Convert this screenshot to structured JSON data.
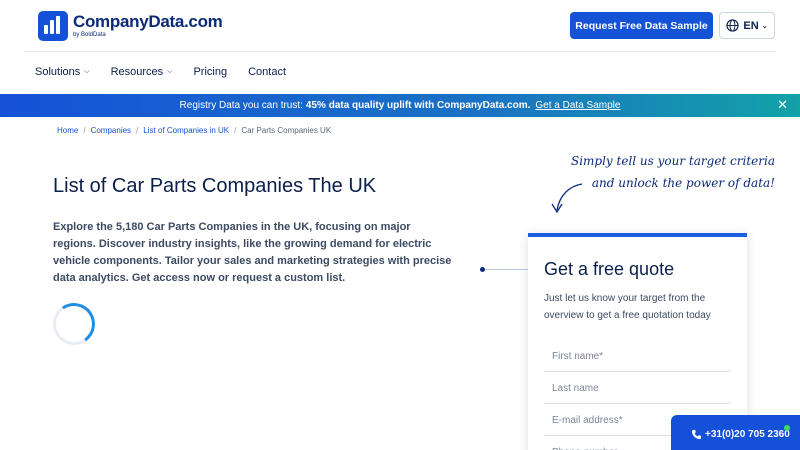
{
  "header": {
    "logo_name": "CompanyData.com",
    "logo_sub": "by BoldData",
    "cta_label": "Request Free Data Sample",
    "language": "EN"
  },
  "nav": {
    "items": [
      {
        "label": "Solutions",
        "has_dropdown": true
      },
      {
        "label": "Resources",
        "has_dropdown": true
      },
      {
        "label": "Pricing",
        "has_dropdown": false
      },
      {
        "label": "Contact",
        "has_dropdown": false
      }
    ]
  },
  "banner": {
    "text": "Registry Data you can trust:",
    "highlight": "45% data quality uplift with CompanyData.com.",
    "link": "Get a Data Sample",
    "close_icon": "close-icon"
  },
  "breadcrumb": [
    "Home",
    "Companies",
    "List of Companies in UK",
    "Car Parts Companies UK"
  ],
  "main": {
    "title": "List of Car Parts Companies The UK",
    "description": "Explore the 5,180 Car Parts Companies in the UK, focusing on major regions. Discover industry insights, like the growing demand for electric vehicle components. Tailor your sales and marketing strategies with precise data analytics. Get access now or request a custom list."
  },
  "callout": {
    "line1": "Simply tell us your target criteria",
    "line2": "and unlock the power of data!"
  },
  "quote_form": {
    "title": "Get a free quote",
    "text": "Just let us know your target from the overview to get a free quotation today",
    "fields": [
      {
        "placeholder": "First name*"
      },
      {
        "placeholder": "Last name"
      },
      {
        "placeholder": "E-mail address*"
      },
      {
        "placeholder": "Phone number"
      }
    ]
  },
  "phone": {
    "number": "+31(0)20 705 2360"
  },
  "colors": {
    "brand": "#1450d8",
    "text_dark": "#0b1f4b",
    "online": "#3ddc5a"
  }
}
